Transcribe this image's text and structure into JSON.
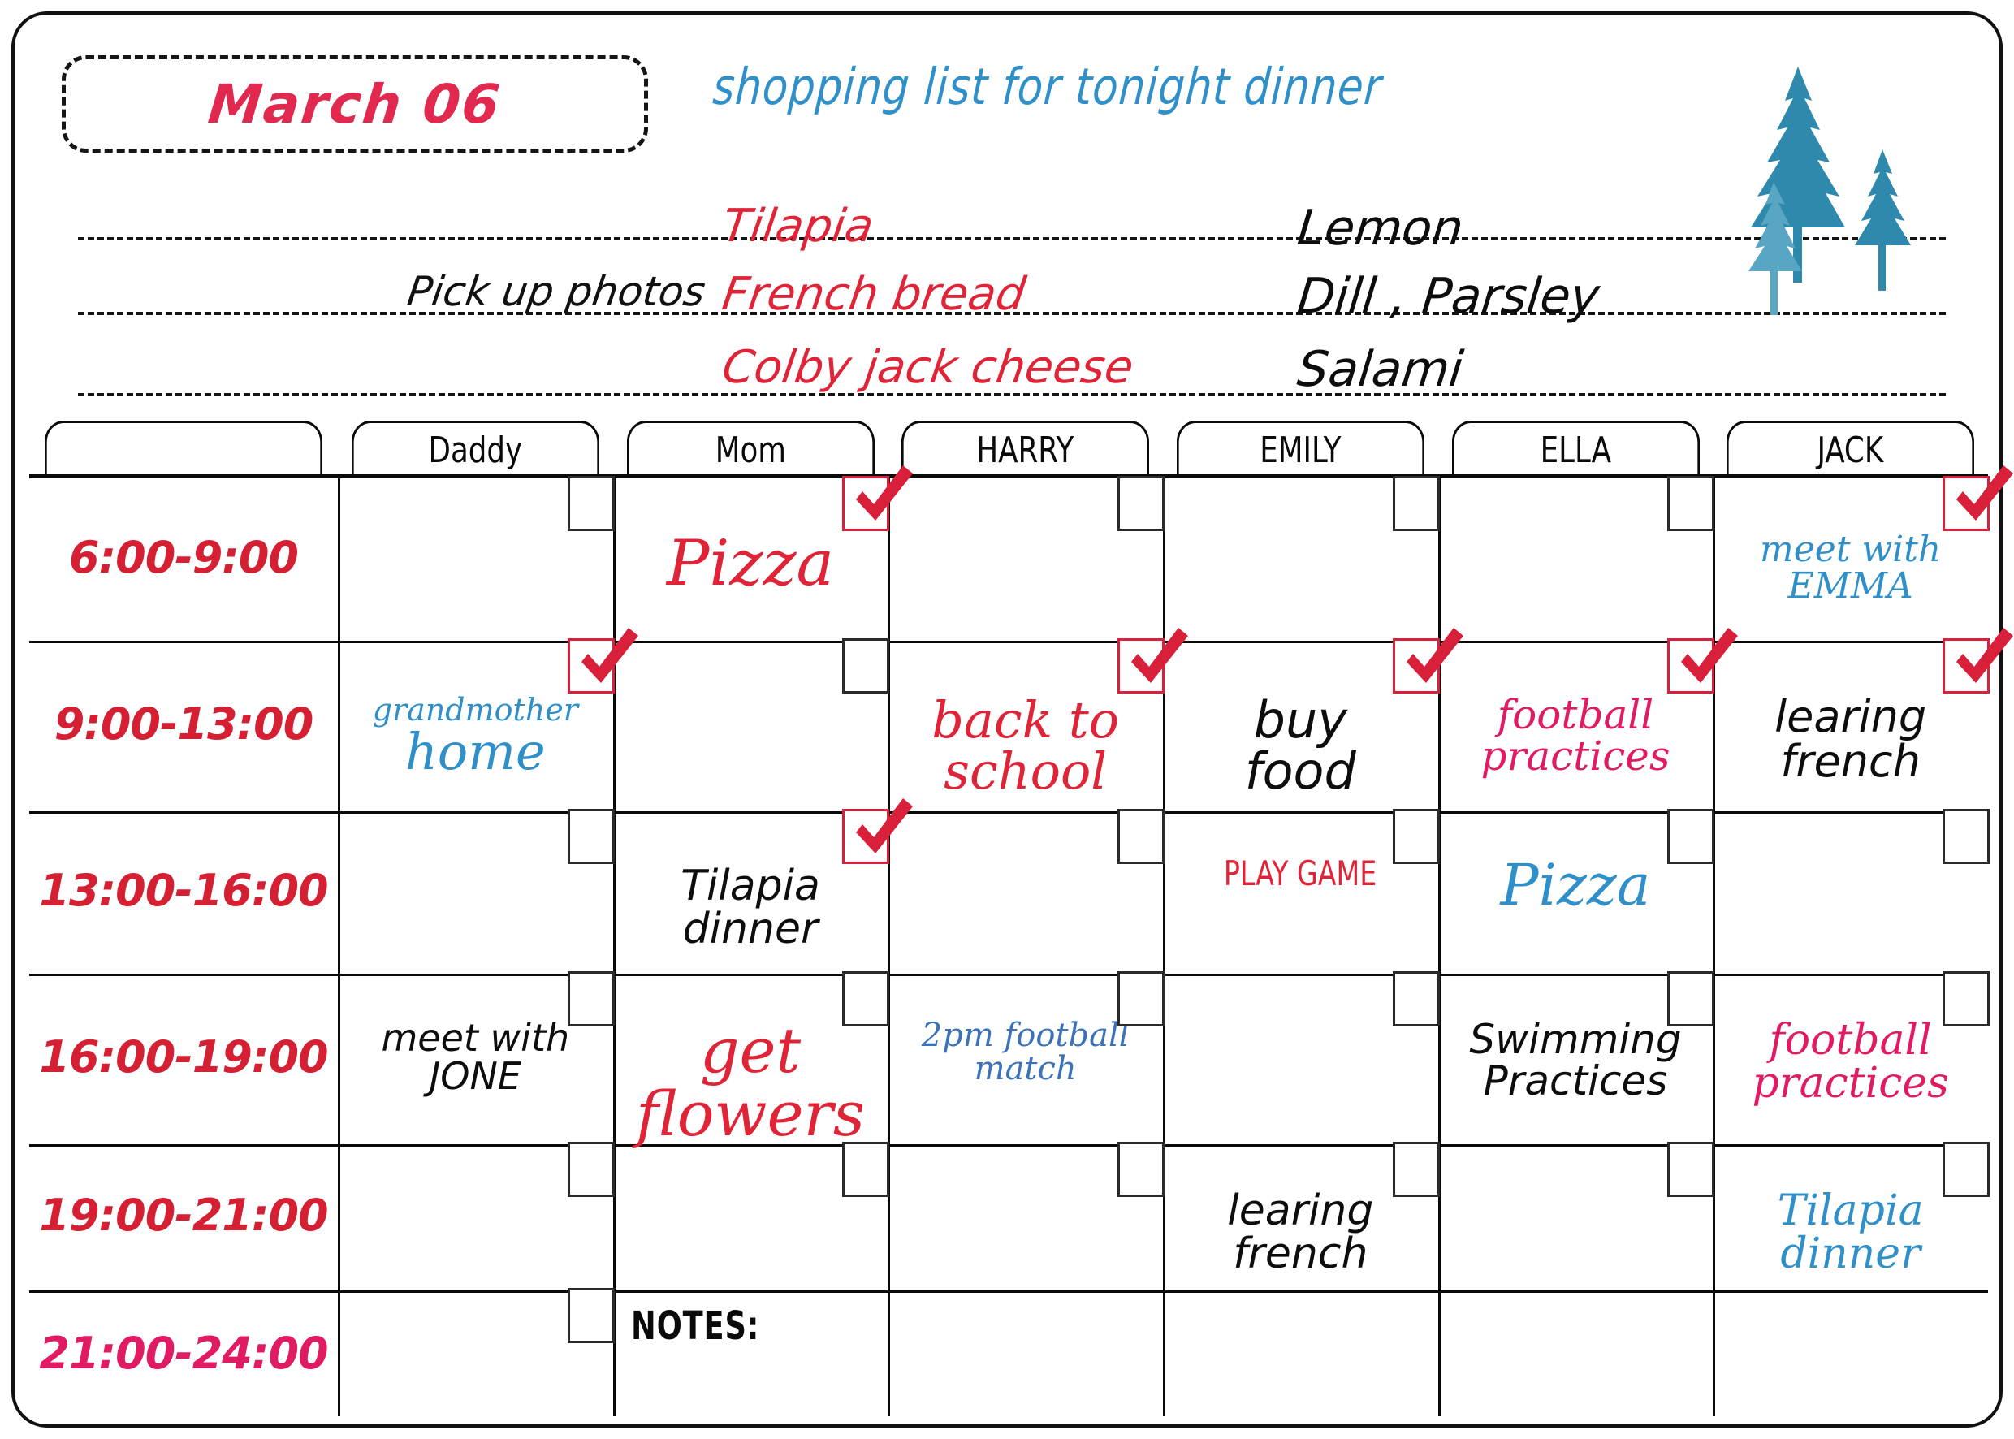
{
  "board": {
    "date_label": "March 06",
    "shopping_title": "shopping list for tonight dinner",
    "notes_label": "NOTES:",
    "decoration": "pine-trees"
  },
  "colors": {
    "red": "#e02438",
    "crimson": "#d42032",
    "pink": "#e01a63",
    "blue": "#2f8fc9",
    "steel_blue": "#3b72b8",
    "black": "#0d0d0d",
    "tree_teal": "#2f89ad",
    "tree_light": "#59a6c4"
  },
  "shopping_list": {
    "left_column": [
      {
        "text": "",
        "color": "black"
      },
      {
        "text": "Pick up photos",
        "color": "black"
      },
      {
        "text": "",
        "color": "black"
      }
    ],
    "middle_column": [
      {
        "text": "Tilapia",
        "color": "red"
      },
      {
        "text": "French bread",
        "color": "red"
      },
      {
        "text": "Colby jack cheese",
        "color": "red"
      }
    ],
    "right_column": [
      {
        "text": "Lemon",
        "color": "black"
      },
      {
        "text": "Dill , Parsley",
        "color": "black"
      },
      {
        "text": "Salami",
        "color": "black"
      }
    ]
  },
  "columns": [
    {
      "name": "time",
      "label": ""
    },
    {
      "name": "daddy",
      "label": "Daddy"
    },
    {
      "name": "mom",
      "label": "Mom"
    },
    {
      "name": "harry",
      "label": "HARRY"
    },
    {
      "name": "emily",
      "label": "EMILY"
    },
    {
      "name": "ella",
      "label": "ELLA"
    },
    {
      "name": "jack",
      "label": "JACK"
    }
  ],
  "rows": [
    {
      "time": "6:00-9:00"
    },
    {
      "time": "9:00-13:00"
    },
    {
      "time": "13:00-16:00"
    },
    {
      "time": "16:00-19:00"
    },
    {
      "time": "19:00-21:00"
    },
    {
      "time": "21:00-24:00"
    }
  ],
  "entries": [
    {
      "row": 0,
      "col": "mom",
      "text": "Pizza",
      "color": "red",
      "size": 78,
      "style": "script",
      "checked": true
    },
    {
      "row": 0,
      "col": "jack",
      "text": "meet with\nEMMA",
      "color": "blue",
      "size": 44,
      "style": "script",
      "checked": true
    },
    {
      "row": 1,
      "col": "daddy",
      "text": "grandmother",
      "color": "blue",
      "size": 38,
      "style": "script",
      "checked": true,
      "sub": "home",
      "sub_size": 62
    },
    {
      "row": 1,
      "col": "harry",
      "text": "back to\nschool",
      "color": "red",
      "size": 62,
      "style": "script",
      "checked": true
    },
    {
      "row": 1,
      "col": "emily",
      "text": "buy\nfood",
      "color": "black",
      "size": 62,
      "style": "hw",
      "checked": true
    },
    {
      "row": 1,
      "col": "ella",
      "text": "football\npractices",
      "color": "pink",
      "size": 50,
      "style": "script",
      "checked": true
    },
    {
      "row": 1,
      "col": "jack",
      "text": "learing\nfrench",
      "color": "black",
      "size": 54,
      "style": "hw",
      "checked": true
    },
    {
      "row": 2,
      "col": "mom",
      "text": "Tilapia\ndinner",
      "color": "black",
      "size": 52,
      "style": "hw",
      "checked": true
    },
    {
      "row": 2,
      "col": "emily",
      "text": "PLAY GAME",
      "color": "red",
      "size": 42,
      "style": "caps",
      "checked": false
    },
    {
      "row": 2,
      "col": "ella",
      "text": "Pizza",
      "color": "blue",
      "size": 70,
      "style": "script",
      "checked": false
    },
    {
      "row": 3,
      "col": "daddy",
      "text": "meet with\nJONE",
      "color": "black",
      "size": 46,
      "style": "hw",
      "checked": false
    },
    {
      "row": 3,
      "col": "mom",
      "text": "get\nflowers",
      "color": "red",
      "size": 76,
      "style": "script",
      "checked": false
    },
    {
      "row": 3,
      "col": "harry",
      "text": "2pm football\nmatch",
      "color": "steel_blue",
      "size": 40,
      "style": "script",
      "checked": false
    },
    {
      "row": 3,
      "col": "ella",
      "text": "Swimming\nPractices",
      "color": "black",
      "size": 50,
      "style": "hw",
      "checked": false
    },
    {
      "row": 3,
      "col": "jack",
      "text": "football\npractices",
      "color": "pink",
      "size": 52,
      "style": "script",
      "checked": false
    },
    {
      "row": 4,
      "col": "emily",
      "text": "learing\nfrench",
      "color": "black",
      "size": 52,
      "style": "hw",
      "checked": false
    },
    {
      "row": 4,
      "col": "jack",
      "text": "Tilapia\ndinner",
      "color": "blue",
      "size": 52,
      "style": "script",
      "checked": false
    }
  ]
}
